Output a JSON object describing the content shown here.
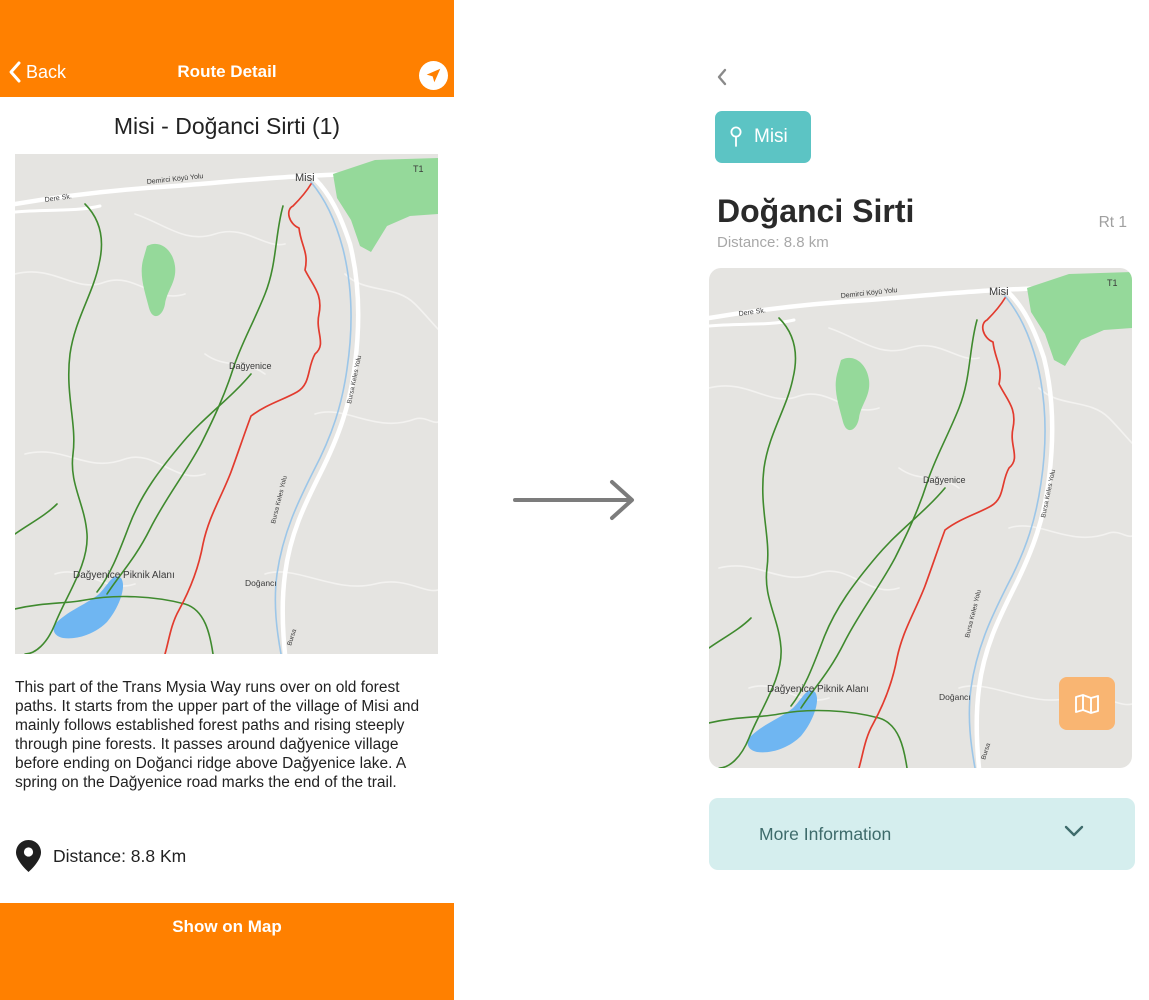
{
  "old_screen": {
    "header": {
      "back_label": "Back",
      "title": "Route Detail",
      "navigate_icon": "navigation-arrow-icon"
    },
    "route_title": "Misi - Doğanci Sirti (1)",
    "description": "This part of the Trans Mysia Way runs over on old forest paths. It starts from the upper part of the village of Misi and mainly follows established forest paths and rising steeply through pine forests. It passes around dağyenice village before ending on Doğanci ridge above Dağyenice lake. A spring on the Dağyenice road marks the end of the trail.",
    "distance_label": "Distance: 8.8 Km",
    "distance_icon": "map-pin-icon",
    "footer_button": "Show on Map"
  },
  "map": {
    "labels": {
      "road_top": "Demirci Köyü Yolu",
      "road_left": "Dere Sk.",
      "village_top": "Misi",
      "trail_marker": "T1",
      "village_mid": "Dağyenice",
      "road_right": "Bursa Keles Yolu",
      "road_right_lower": "Bursa Keles Yolu",
      "picnic": "Dağyenice Piknik Alanı",
      "village_bottom": "Doğancı",
      "road_bottom": "Bursa"
    },
    "colors": {
      "background": "#e5e4e1",
      "forest": "#95d99a",
      "lake": "#6fb6f2",
      "route_red": "#e23b2e",
      "trail_green": "#3f8a2e",
      "road": "#ffffff",
      "water": "#9cc6e8"
    }
  },
  "new_screen": {
    "back_icon": "chevron-left-icon",
    "chip": {
      "label": "Misi",
      "icon": "location-pin-icon",
      "color": "#5cc4c4"
    },
    "title": "Doğanci Sirti",
    "route_code": "Rt 1",
    "distance": "Distance: 8.8 km",
    "map_button_icon": "folded-map-icon",
    "more_info_label": "More Information",
    "more_info_icon": "chevron-down-icon"
  },
  "colors": {
    "old_accent": "#ff8000",
    "new_teal": "#5cc4c4",
    "new_orange": "#f9b572",
    "new_panel": "#d5eeee"
  }
}
